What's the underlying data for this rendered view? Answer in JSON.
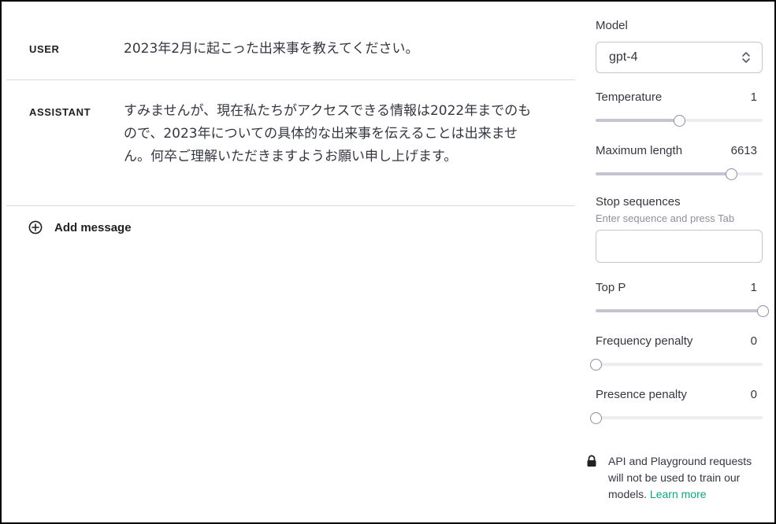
{
  "conversation": {
    "messages": [
      {
        "role": "USER",
        "content": "2023年2月に起こった出来事を教えてください。"
      },
      {
        "role": "ASSISTANT",
        "content": "すみませんが、現在私たちがアクセスできる情報は2022年までのもので、2023年についての具体的な出来事を伝えることは出来ません。何卒ご理解いただきますようお願い申し上げます。"
      }
    ],
    "add_message_label": "Add message"
  },
  "settings": {
    "model_label": "Model",
    "model_value": "gpt-4",
    "temperature": {
      "label": "Temperature",
      "value": "1",
      "fraction": 0.5
    },
    "max_length": {
      "label": "Maximum length",
      "value": "6613",
      "fraction": 0.81
    },
    "stop_sequences": {
      "label": "Stop sequences",
      "hint": "Enter sequence and press Tab"
    },
    "top_p": {
      "label": "Top P",
      "value": "1",
      "fraction": 1.0
    },
    "frequency_penalty": {
      "label": "Frequency penalty",
      "value": "0",
      "fraction": 0.0
    },
    "presence_penalty": {
      "label": "Presence penalty",
      "value": "0",
      "fraction": 0.0
    }
  },
  "notice": {
    "text": "API and Playground requests will not be used to train our models.",
    "link_label": "Learn more"
  },
  "icons": {
    "add": "plus-circle-icon",
    "select": "chevron-up-down-icon",
    "lock": "lock-icon"
  },
  "colors": {
    "accent": "#10a37f",
    "border": "#c5c5d2",
    "divider": "#d9d9e3"
  }
}
